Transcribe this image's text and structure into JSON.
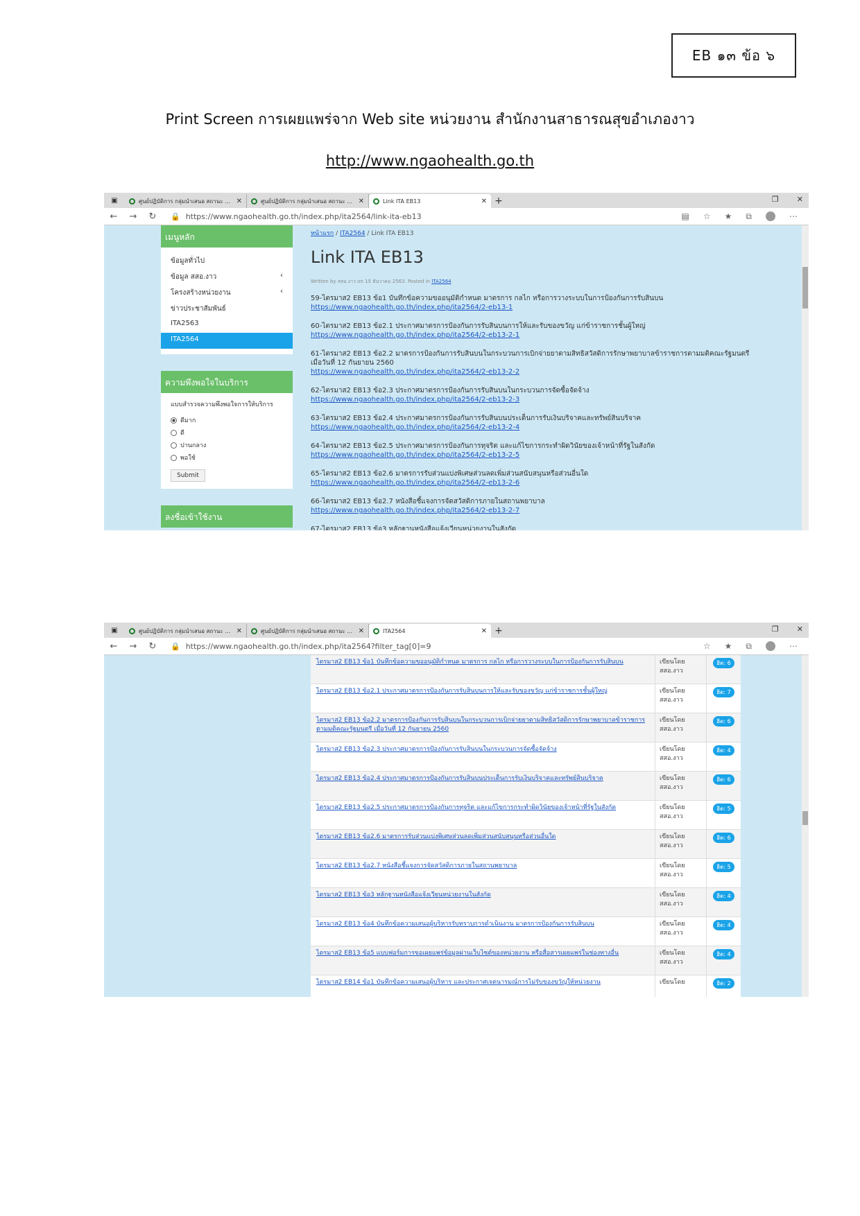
{
  "doc": {
    "tag": "EB ๑๓   ข้อ ๖",
    "title": "Print Screen การเผยแพร่จาก Web site หน่วยงาน สำนักงานสาธารณสุขอำเภองาว",
    "url": "http://www.ngaohealth.go.th"
  },
  "shot1": {
    "tabs": [
      {
        "title": "ศูนย์ปฏิบัติการ กลุ่มนำเสนอ สถานะ ความเสี่ยง (ศบ"
      },
      {
        "title": "ศูนย์ปฏิบัติการ กลุ่มนำเสนอ สถานะ ทะเบียน"
      },
      {
        "title": "Link ITA EB13"
      }
    ],
    "address": "https://www.ngaohealth.go.th/index.php/ita2564/link-ita-eb13",
    "menu_title": "เมนูหลัก",
    "menu": [
      {
        "label": "ข้อมูลทั่วไป",
        "arrow": ""
      },
      {
        "label": "ข้อมูล สสอ.งาว",
        "arrow": "‹"
      },
      {
        "label": "โครงสร้างหน่วยงาน",
        "arrow": "‹"
      },
      {
        "label": "ข่าวประชาสัมพันธ์",
        "arrow": ""
      },
      {
        "label": "ITA2563",
        "arrow": ""
      },
      {
        "label": "ITA2564",
        "arrow": ""
      }
    ],
    "survey_title": "ความพึงพอใจในบริการ",
    "survey_question": "แบบสำรวจความพึงพอใจการให้บริการ",
    "survey_options": [
      "ดีมาก",
      "ดี",
      "ปานกลาง",
      "พอใช้"
    ],
    "submit": "Submit",
    "login_title": "ลงชื่อเข้าใช้งาน",
    "breadcrumb": {
      "home": "หน้าแรก",
      "sep1": "/",
      "section": "ITA2564",
      "sep2": "/",
      "current": "Link ITA EB13"
    },
    "heading": "Link ITA EB13",
    "meta_text": "Written by สสอ.งาว on 15 ธันวาคม 2563. Posted in",
    "meta_link": "ITA2564",
    "entries": [
      {
        "text": "59-ไตรมาส2 EB13 ข้อ1 บันทึกข้อความขออนุมัติกำหนด มาตรการ กลไก หรือการวางระบบในการป้องกันการรับสินบน",
        "link": "https://www.ngaohealth.go.th/index.php/ita2564/2-eb13-1"
      },
      {
        "text": "60-ไตรมาส2 EB13 ข้อ2.1 ประกาศมาตรการป้องกันการรับสินบนการให้และรับของขวัญ แก่ข้าราชการชั้นผู้ใหญ่",
        "link": "https://www.ngaohealth.go.th/index.php/ita2564/2-eb13-2-1"
      },
      {
        "text": "61-ไตรมาส2 EB13 ข้อ2.2 มาตรการป้องกันการรับสินบนในกระบวนการเบิกจ่ายยาตามสิทธิสวัสดิการรักษาพยาบาลข้าราชการตามมติคณะรัฐมนตรี เมื่อวันที่ 12 กันยายน 2560",
        "link": "https://www.ngaohealth.go.th/index.php/ita2564/2-eb13-2-2"
      },
      {
        "text": "62-ไตรมาส2 EB13 ข้อ2.3 ประกาศมาตรการป้องกันการรับสินบนในกระบวนการจัดซื้อจัดจ้าง",
        "link": "https://www.ngaohealth.go.th/index.php/ita2564/2-eb13-2-3"
      },
      {
        "text": "63-ไตรมาส2 EB13 ข้อ2.4 ประกาศมาตรการป้องกันการรับสินบนประเด็นการรับเงินบริจาคและทรัพย์สินบริจาค",
        "link": "https://www.ngaohealth.go.th/index.php/ita2564/2-eb13-2-4"
      },
      {
        "text": "64-ไตรมาส2 EB13 ข้อ2.5 ประกาศมาตรการป้องกันการทุจริต และแก้ไขการกระทำผิดวินัยของเจ้าหน้าที่รัฐในสังกัด",
        "link": "https://www.ngaohealth.go.th/index.php/ita2564/2-eb13-2-5"
      },
      {
        "text": "65-ไตรมาส2 EB13 ข้อ2.6 มาตรการรับส่วนแบ่งพิเศษส่วนลดเพิ่มส่วนสนับสนุนหรือส่วนอื่นใด",
        "link": "https://www.ngaohealth.go.th/index.php/ita2564/2-eb13-2-6"
      },
      {
        "text": "66-ไตรมาส2 EB13 ข้อ2.7 หนังสือชี้แจงการจัดสวัสดิการภายในสถานพยาบาล",
        "link": "https://www.ngaohealth.go.th/index.php/ita2564/2-eb13-2-7"
      },
      {
        "text": "67-ไตรมาส2 EB13 ข้อ3 หลักฐานหนังสือแจ้งเวียนหน่วยงานในสังกัด",
        "link": ""
      }
    ]
  },
  "shot2": {
    "tabs": [
      {
        "title": "ศูนย์ปฏิบัติการ กลุ่มนำเสนอ สถานะ ความเสี่ยง (ศบ"
      },
      {
        "title": "ศูนย์ปฏิบัติการ กลุ่มนำเสนอ สถานะ ทะเบียน"
      },
      {
        "title": "ITA2564"
      }
    ],
    "address": "https://www.ngaohealth.go.th/index.php/ita2564?filter_tag[0]=9",
    "rows": [
      {
        "title": "ไตรมาส2 EB13 ข้อ1 บันทึกข้อความขออนุมัติกำหนด มาตรการ กลไก หรือการวางระบบในการป้องกันการรับสินบน",
        "author": "เขียนโดย สสอ.งาว",
        "hits": "ฮิต: 6"
      },
      {
        "title": "ไตรมาส2 EB13 ข้อ2.1 ประกาศมาตรการป้องกันการรับสินบนการให้และรับของขวัญ แก่ข้าราชการชั้นผู้ใหญ่",
        "author": "เขียนโดย สสอ.งาว",
        "hits": "ฮิต: 7"
      },
      {
        "title": "ไตรมาส2 EB13 ข้อ2.2 มาตรการป้องกันการรับสินบนในกระบวนการเบิกจ่ายยาตามสิทธิสวัสดิการรักษาพยาบาลข้าราชการตามมติคณะรัฐมนตรี เมื่อวันที่ 12 กันยายน 2560",
        "author": "เขียนโดย สสอ.งาว",
        "hits": "ฮิต: 6"
      },
      {
        "title": "ไตรมาส2 EB13 ข้อ2.3 ประกาศมาตรการป้องกันการรับสินบนในกระบวนการจัดซื้อจัดจ้าง",
        "author": "เขียนโดย สสอ.งาว",
        "hits": "ฮิต: 4"
      },
      {
        "title": "ไตรมาส2 EB13 ข้อ2.4 ประกาศมาตรการป้องกันการรับสินบนประเด็นการรับเงินบริจาคและทรัพย์สินบริจาค",
        "author": "เขียนโดย สสอ.งาว",
        "hits": "ฮิต: 6"
      },
      {
        "title": "ไตรมาส2 EB13 ข้อ2.5 ประกาศมาตรการป้องกันการทุจริต และแก้ไขการกระทำผิดวินัยของเจ้าหน้าที่รัฐในสังกัด",
        "author": "เขียนโดย สสอ.งาว",
        "hits": "ฮิต: 5"
      },
      {
        "title": "ไตรมาส2 EB13 ข้อ2.6 มาตรการรับส่วนแบ่งพิเศษส่วนลดเพิ่มส่วนสนับสนุนหรือส่วนอื่นใด",
        "author": "เขียนโดย สสอ.งาว",
        "hits": "ฮิต: 6"
      },
      {
        "title": "ไตรมาส2 EB13 ข้อ2.7 หนังสือชี้แจงการจัดสวัสดิการภายในสถานพยาบาล",
        "author": "เขียนโดย สสอ.งาว",
        "hits": "ฮิต: 5"
      },
      {
        "title": "ไตรมาส2 EB13 ข้อ3 หลักฐานหนังสือแจ้งเวียนหน่วยงานในสังกัด",
        "author": "เขียนโดย สสอ.งาว",
        "hits": "ฮิต: 4"
      },
      {
        "title": "ไตรมาส2 EB13 ข้อ4 บันทึกข้อความเสนอผู้บริหารรับทราบการดำเนินงาน มาตรการป้องกันการรับสินบน",
        "author": "เขียนโดย สสอ.งาว",
        "hits": "ฮิต: 4"
      },
      {
        "title": "ไตรมาส2 EB13 ข้อ5 แบบฟอร์มการขอเผยแพร่ข้อมูลผ่านเว็บไซต์ของหน่วยงาน หรือสื่อสารเผยแพร่ในช่องทางอื่น",
        "author": "เขียนโดย สสอ.งาว",
        "hits": "ฮิต: 4"
      },
      {
        "title": "ไตรมาส2 EB14 ข้อ1 บันทึกข้อความเสนอผู้บริหาร และประกาศเจตนารมณ์การไม่รับของขวัญให้หน่วยงาน",
        "author": "เขียนโดย",
        "hits": "ฮิต: 2"
      }
    ]
  }
}
